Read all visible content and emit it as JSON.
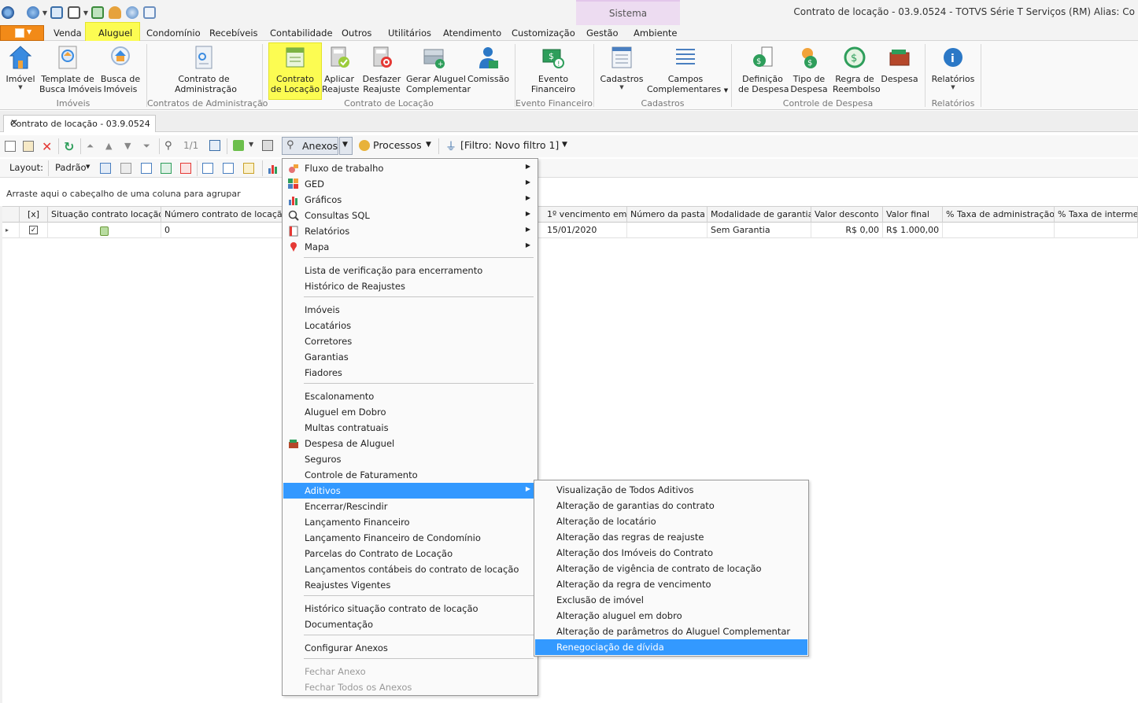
{
  "window": {
    "title": "Contrato de locação - 03.9.0524 - TOTVS Série T Serviços (RM) Alias: Co",
    "context_tab": "Sistema"
  },
  "ribbon_tabs": [
    "Venda",
    "Aluguel",
    "Condomínio",
    "Recebíveis",
    "Contabilidade",
    "Outros",
    "Utilitários",
    "Atendimento",
    "Customização",
    "Gestão",
    "Ambiente"
  ],
  "active_tab": "Aluguel",
  "ribbon": {
    "imovel": {
      "l1": "Imóvel"
    },
    "template": {
      "l1": "Template de",
      "l2": "Busca Imóveis"
    },
    "busca": {
      "l1": "Busca de",
      "l2": "Imóveis"
    },
    "g_imoveis": "Imóveis",
    "contrato_adm": {
      "l1": "Contrato de",
      "l2": "Administração"
    },
    "g_contratos_adm": "Contratos de Administração",
    "contrato_loc": {
      "l1": "Contrato",
      "l2": "de Locação"
    },
    "aplicar": {
      "l1": "Aplicar",
      "l2": "Reajuste"
    },
    "desfazer": {
      "l1": "Desfazer",
      "l2": "Reajuste"
    },
    "gerar": {
      "l1": "Gerar Aluguel",
      "l2": "Complementar"
    },
    "comissao": {
      "l1": "Comissão"
    },
    "g_contrato_loc": "Contrato de Locação",
    "evento": {
      "l1": "Evento",
      "l2": "Financeiro"
    },
    "g_evento": "Evento Financeiro",
    "cadastros": {
      "l1": "Cadastros"
    },
    "campos": {
      "l1": "Campos",
      "l2": "Complementares"
    },
    "g_cadastros": "Cadastros",
    "definicao": {
      "l1": "Definição",
      "l2": "de Despesa"
    },
    "tipo": {
      "l1": "Tipo de",
      "l2": "Despesa"
    },
    "regra": {
      "l1": "Regra de",
      "l2": "Reembolso"
    },
    "despesa": {
      "l1": "Despesa"
    },
    "g_despesa": "Controle de Despesa",
    "relatorios": {
      "l1": "Relatórios"
    },
    "g_relatorios": "Relatórios"
  },
  "doc_tab": {
    "title": "Contrato de locação - 03.9.0524"
  },
  "toolbar": {
    "nav_count": "1/1",
    "anexos": "Anexos",
    "processos": "Processos",
    "filtro": "[Filtro: Novo filtro 1]",
    "layout_label": "Layout:",
    "layout_value": "Padrão"
  },
  "grid": {
    "group_hint": "Arraste aqui o cabeçalho de uma coluna para agrupar",
    "columns": [
      "[x]",
      "Situação contrato locação",
      "Número contrato de locação",
      "1º vencimento em",
      "Número da pasta",
      "Modalidade de garantia",
      "Valor desconto",
      "Valor final",
      "% Taxa de administração",
      "% Taxa de intermedia"
    ],
    "row": {
      "numero": "0",
      "vencimento": "15/01/2020",
      "pasta": "",
      "modalidade": "Sem Garantia",
      "desconto": "R$ 0,00",
      "final": "R$ 1.000,00",
      "taxa_adm": "",
      "taxa_int": ""
    }
  },
  "anexos_menu": {
    "items": [
      "Fluxo de trabalho",
      "GED",
      "Gráficos",
      "Consultas SQL",
      "Relatórios",
      "Mapa",
      "Lista de verificação para encerramento",
      "Histórico de Reajustes",
      "Imóveis",
      "Locatários",
      "Corretores",
      "Garantias",
      "Fiadores",
      "Escalonamento",
      "Aluguel em Dobro",
      "Multas contratuais",
      "Despesa de Aluguel",
      "Seguros",
      "Controle de Faturamento",
      "Aditivos",
      "Encerrar/Rescindir",
      "Lançamento Financeiro",
      "Lançamento Financeiro de Condomínio",
      "Parcelas do Contrato de Locação",
      "Lançamentos contábeis do contrato de locação",
      "Reajustes Vigentes",
      "Histórico situação contrato de locação",
      "Documentação",
      "Configurar Anexos",
      "Fechar Anexo",
      "Fechar Todos os Anexos"
    ],
    "selected": "Aditivos"
  },
  "aditivos_menu": {
    "items": [
      "Visualização de Todos Aditivos",
      "Alteração de garantias do contrato",
      "Alteração de locatário",
      "Alteração das regras de reajuste",
      "Alteração dos Imóveis do Contrato",
      "Alteração de vigência de contrato de locação",
      "Alteração da regra de vencimento",
      "Exclusão de imóvel",
      "Alteração aluguel em dobro",
      "Alteração de parâmetros do Aluguel Complementar",
      "Renegociação de dívida"
    ],
    "selected": "Renegociação de dívida"
  },
  "colors": {
    "accent": "#3399ff",
    "highlight": "#fcfc52",
    "file_tab": "#f28a18",
    "context_tab": "#eddcf1"
  }
}
